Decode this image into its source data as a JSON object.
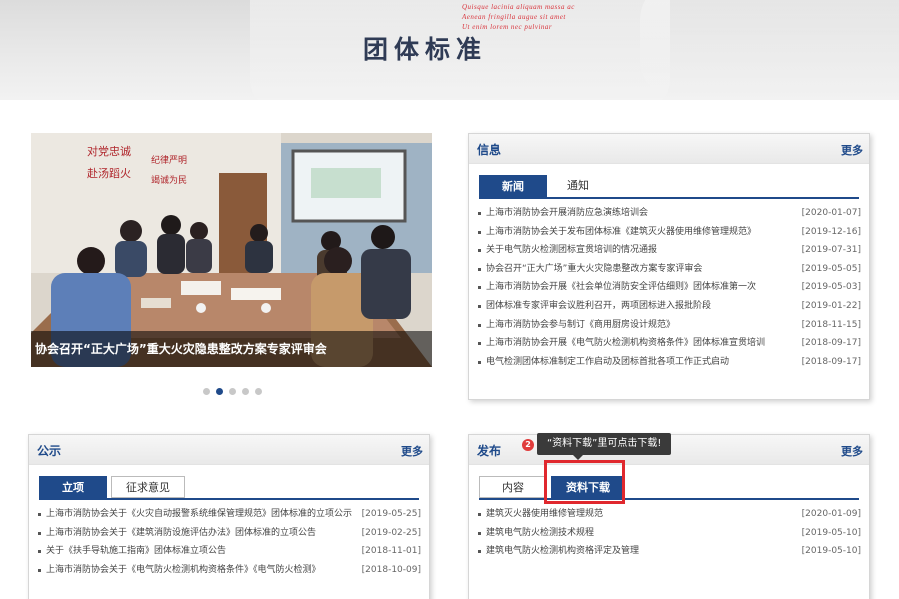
{
  "banner": {
    "title": "团体标准",
    "deco_lines": [
      "Quisque lacinia aliquam massa ac ",
      "Aenean fringilla augue sit amet",
      "Ut enim lorem nec pulvinar"
    ]
  },
  "slider": {
    "caption": "协会召开“正大广场”重大火灾隐患整改方案专家评审会",
    "wall_text": [
      "对党忠诚",
      "纪律严明",
      "赴汤蹈火",
      "竭诚为民"
    ],
    "active_index": 1,
    "dots": 5
  },
  "info_panel": {
    "title": "信息",
    "more": "更多",
    "tabs": [
      "新闻",
      "通知"
    ],
    "items": [
      {
        "text": "上海市消防协会开展消防应急演练培训会",
        "date": "[2020-01-07]"
      },
      {
        "text": "上海市消防协会关于发布团体标准《建筑灭火器使用维修管理规范》",
        "date": "[2019-12-16]"
      },
      {
        "text": "关于电气防火检测团标宣贯培训的情况通报",
        "date": "[2019-07-31]"
      },
      {
        "text": "协会召开“正大广场”重大火灾隐患整改方案专家评审会",
        "date": "[2019-05-05]"
      },
      {
        "text": "上海市消防协会开展《社会单位消防安全评估细则》团体标准第一次",
        "date": "[2019-05-03]"
      },
      {
        "text": "团体标准专家评审会议胜利召开，两项团标进入报批阶段",
        "date": "[2019-01-22]"
      },
      {
        "text": "上海市消防协会参与制订《商用厨房设计规范》",
        "date": "[2018-11-15]"
      },
      {
        "text": "上海市消防协会开展《电气防火检测机构资格条件》团体标准宣贯培训",
        "date": "[2018-09-17]"
      },
      {
        "text": "电气检测团体标准制定工作启动及团标首批各项工作正式启动",
        "date": "[2018-09-17]"
      }
    ]
  },
  "notice_panel": {
    "title": "公示",
    "more": "更多",
    "tabs": [
      "立项",
      "征求意见"
    ],
    "items": [
      {
        "text": "上海市消防协会关于《火灾自动报警系统维保管理规范》团体标准的立项公示",
        "date": "[2019-05-25]"
      },
      {
        "text": "上海市消防协会关于《建筑消防设施评估办法》团体标准的立项公告",
        "date": "[2019-02-25]"
      },
      {
        "text": "关于《扶手导轨施工指南》团体标准立项公告",
        "date": "[2018-11-01]"
      },
      {
        "text": "上海市消防协会关于《电气防火检测机构资格条件》《电气防火检测》",
        "date": "[2018-10-09]"
      }
    ]
  },
  "publish_panel": {
    "title": "发布",
    "more": "更多",
    "tabs": [
      "内容",
      "资料下载"
    ],
    "items": [
      {
        "text": "建筑灭火器使用维修管理规范",
        "date": "[2020-01-09]"
      },
      {
        "text": "建筑电气防火检测技术规程",
        "date": "[2019-05-10]"
      },
      {
        "text": "建筑电气防火检测机构资格评定及管理",
        "date": "[2019-05-10]"
      }
    ]
  },
  "tooltip": {
    "badge": "2",
    "text": "“资料下载”里可点击下载!"
  },
  "colors": {
    "accent": "#1f4a8a",
    "highlight": "#e0282e"
  }
}
